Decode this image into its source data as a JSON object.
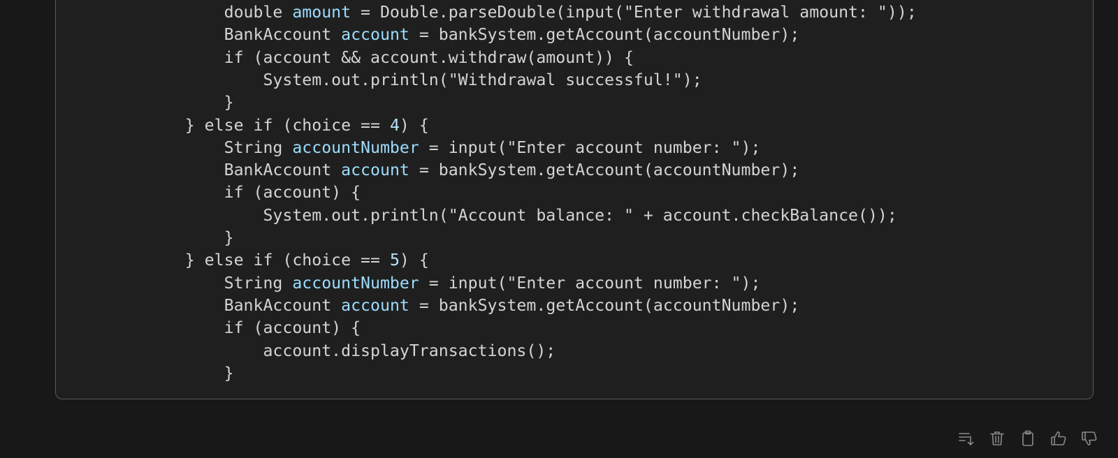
{
  "code": {
    "language": "java",
    "lines": [
      [
        [
          "                    double ",
          ""
        ],
        [
          "amount",
          "v"
        ],
        [
          " = Double.parseDouble(input(\"Enter withdrawal amount: \"));",
          ""
        ]
      ],
      [
        [
          "                    BankAccount ",
          ""
        ],
        [
          "account",
          "v"
        ],
        [
          " = bankSystem.getAccount(accountNumber);",
          ""
        ]
      ],
      [
        [
          "                    if (account && account.withdraw(amount)) {",
          ""
        ]
      ],
      [
        [
          "                        System.out.println(\"Withdrawal successful!\");",
          ""
        ]
      ],
      [
        [
          "                    }",
          ""
        ]
      ],
      [
        [
          "                } else if (choice == ",
          ""
        ],
        [
          "4",
          "n"
        ],
        [
          ") {",
          ""
        ]
      ],
      [
        [
          "                    String ",
          ""
        ],
        [
          "accountNumber",
          "v"
        ],
        [
          " = input(\"Enter account number: \");",
          ""
        ]
      ],
      [
        [
          "                    BankAccount ",
          ""
        ],
        [
          "account",
          "v"
        ],
        [
          " = bankSystem.getAccount(accountNumber);",
          ""
        ]
      ],
      [
        [
          "                    if (account) {",
          ""
        ]
      ],
      [
        [
          "                        System.out.println(\"Account balance: \" + account.checkBalance());",
          ""
        ]
      ],
      [
        [
          "                    }",
          ""
        ]
      ],
      [
        [
          "                } else if (choice == ",
          ""
        ],
        [
          "5",
          "n"
        ],
        [
          ") {",
          ""
        ]
      ],
      [
        [
          "                    String ",
          ""
        ],
        [
          "accountNumber",
          "v"
        ],
        [
          " = input(\"Enter account number: \");",
          ""
        ]
      ],
      [
        [
          "                    BankAccount ",
          ""
        ],
        [
          "account",
          "v"
        ],
        [
          " = bankSystem.getAccount(accountNumber);",
          ""
        ]
      ],
      [
        [
          "                    if (account) {",
          ""
        ]
      ],
      [
        [
          "                        account.displayTransactions();",
          ""
        ]
      ],
      [
        [
          "                    }",
          ""
        ]
      ]
    ]
  },
  "toolbar": [
    {
      "icon": "insert-below-icon"
    },
    {
      "icon": "trash-icon"
    },
    {
      "icon": "clipboard-icon"
    },
    {
      "icon": "thumbs-up-icon"
    },
    {
      "icon": "thumbs-down-icon"
    }
  ],
  "colors": {
    "background": "#181818",
    "code_background": "#1f1f1f",
    "code_text": "#d4d4d4",
    "variable": "#9cdcfe",
    "number": "#b5e3f7",
    "icon": "#8a8a8a"
  }
}
